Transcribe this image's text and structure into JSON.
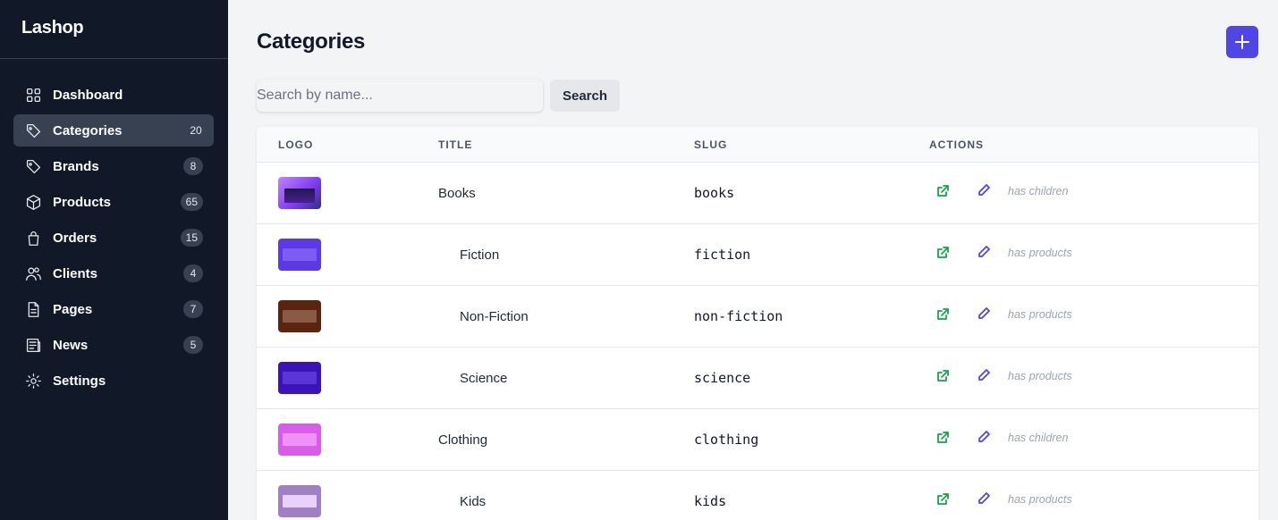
{
  "app": {
    "brand": "Lashop"
  },
  "sidebar": {
    "items": [
      {
        "label": "Dashboard",
        "icon": "dashboard-grid-icon",
        "count": ""
      },
      {
        "label": "Categories",
        "icon": "tag-icon",
        "count": "20",
        "active": true
      },
      {
        "label": "Brands",
        "icon": "tag-icon",
        "count": "8"
      },
      {
        "label": "Products",
        "icon": "cube-icon",
        "count": "65"
      },
      {
        "label": "Orders",
        "icon": "shopping-bag-icon",
        "count": "15"
      },
      {
        "label": "Clients",
        "icon": "users-icon",
        "count": "4"
      },
      {
        "label": "Pages",
        "icon": "document-icon",
        "count": "7"
      },
      {
        "label": "News",
        "icon": "newspaper-icon",
        "count": "5"
      },
      {
        "label": "Settings",
        "icon": "gear-icon",
        "count": ""
      }
    ]
  },
  "header": {
    "title": "Categories",
    "add_icon": "plus-icon"
  },
  "search": {
    "placeholder": "Search by name...",
    "value": "",
    "button_label": "Search"
  },
  "table": {
    "columns": [
      "LOGO",
      "TITLE",
      "SLUG",
      "ACTIONS"
    ],
    "rows": [
      {
        "title": "Books",
        "slug": "books",
        "note": "has children",
        "depth": 0,
        "logo_colors": [
          "#a855f7",
          "#6d28d9"
        ]
      },
      {
        "title": "Fiction",
        "slug": "fiction",
        "note": "has products",
        "depth": 1,
        "logo_colors": [
          "#5b3ae6",
          "#7c5cf2"
        ]
      },
      {
        "title": "Non-Fiction",
        "slug": "non-fiction",
        "note": "has products",
        "depth": 1,
        "logo_colors": [
          "#5a2410",
          "#8a5a44"
        ]
      },
      {
        "title": "Science",
        "slug": "science",
        "note": "has products",
        "depth": 1,
        "logo_colors": [
          "#3b13b8",
          "#5b35d8"
        ]
      },
      {
        "title": "Clothing",
        "slug": "clothing",
        "note": "has children",
        "depth": 0,
        "logo_colors": [
          "#d95ce8",
          "#ee92f5"
        ]
      },
      {
        "title": "Kids",
        "slug": "kids",
        "note": "has products",
        "depth": 1,
        "logo_colors": [
          "#a07fc4",
          "#e9d2fa"
        ]
      }
    ]
  },
  "colors": {
    "sidebar_bg": "#111827",
    "accent": "#4f46e5",
    "open_action": "#16a34a"
  }
}
